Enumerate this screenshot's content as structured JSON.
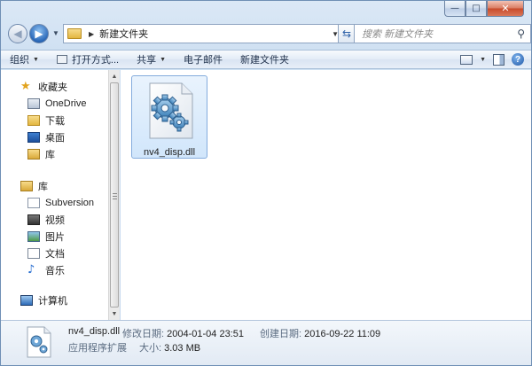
{
  "window": {
    "caption_buttons": {
      "minimize": "—",
      "maximize": "□",
      "close": "✕"
    }
  },
  "address": {
    "path_segment": "新建文件夹",
    "search_placeholder": "搜索 新建文件夹"
  },
  "toolbar": {
    "organize": "组织",
    "open_with": "打开方式...",
    "share": "共享",
    "email": "电子邮件",
    "new_folder": "新建文件夹",
    "help": "?"
  },
  "nav": {
    "favorites": {
      "label": "收藏夹",
      "items": [
        {
          "label": "OneDrive"
        },
        {
          "label": "下载"
        },
        {
          "label": "桌面"
        },
        {
          "label": "库"
        }
      ]
    },
    "libraries": {
      "label": "库",
      "items": [
        {
          "label": "Subversion"
        },
        {
          "label": "视频"
        },
        {
          "label": "图片"
        },
        {
          "label": "文档"
        },
        {
          "label": "音乐"
        }
      ]
    },
    "computer": {
      "label": "计算机"
    }
  },
  "content": {
    "files": [
      {
        "name": "nv4_disp.dll",
        "icon": "dll-gear-icon",
        "selected": true
      }
    ]
  },
  "details": {
    "name": "nv4_disp.dll",
    "type": "应用程序扩展",
    "modified_label": "修改日期:",
    "modified_value": "2004-01-04 23:51",
    "size_label": "大小:",
    "size_value": "3.03 MB",
    "created_label": "创建日期:",
    "created_value": "2016-09-22 11:09"
  },
  "colors": {
    "selection_fill": "#d1e6fb",
    "selection_border": "#84acdd",
    "chrome_blue": "#c4d7ee"
  }
}
